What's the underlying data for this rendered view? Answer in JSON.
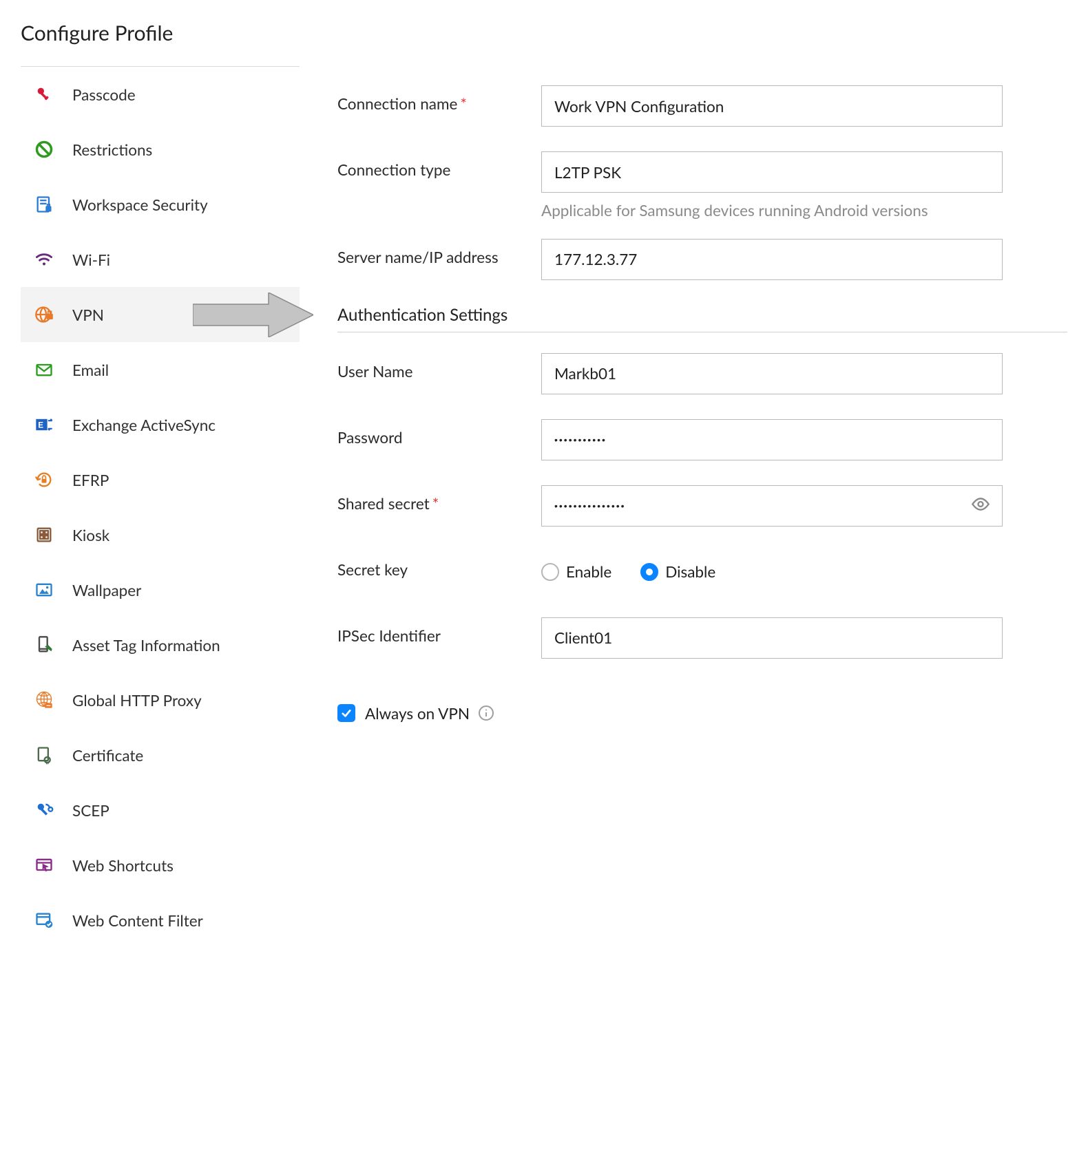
{
  "page_title": "Configure Profile",
  "sidebar": {
    "items": [
      {
        "label": "Passcode",
        "icon": "key-icon",
        "color": "#d81b3a"
      },
      {
        "label": "Restrictions",
        "icon": "prohibit-icon",
        "color": "#2e9b20"
      },
      {
        "label": "Workspace Security",
        "icon": "doc-shield-icon",
        "color": "#2c7bd4"
      },
      {
        "label": "Wi-Fi",
        "icon": "wifi-icon",
        "color": "#6a2b7a"
      },
      {
        "label": "VPN",
        "icon": "globe-lock-icon",
        "color": "#e87b2b",
        "active": true
      },
      {
        "label": "Email",
        "icon": "mail-icon",
        "color": "#2a9d1f"
      },
      {
        "label": "Exchange ActiveSync",
        "icon": "exchange-icon",
        "color": "#1e62c6"
      },
      {
        "label": "EFRP",
        "icon": "lock-rotate-icon",
        "color": "#e67e22"
      },
      {
        "label": "Kiosk",
        "icon": "kiosk-icon",
        "color": "#8a5a3b"
      },
      {
        "label": "Wallpaper",
        "icon": "image-icon",
        "color": "#2a83d1"
      },
      {
        "label": "Asset Tag Information",
        "icon": "phone-tag-icon",
        "color": "#4a4a4a"
      },
      {
        "label": "Global HTTP Proxy",
        "icon": "globe-proxy-icon",
        "color": "#e87b2b"
      },
      {
        "label": "Certificate",
        "icon": "certificate-icon",
        "color": "#4d6b4d"
      },
      {
        "label": "SCEP",
        "icon": "scep-icon",
        "color": "#1d6fd6"
      },
      {
        "label": "Web Shortcuts",
        "icon": "web-shortcut-icon",
        "color": "#8a2a8a"
      },
      {
        "label": "Web Content Filter",
        "icon": "web-filter-icon",
        "color": "#2a83d1"
      }
    ]
  },
  "form": {
    "connection_name": {
      "label": "Connection name",
      "required": true,
      "value": "Work VPN Configuration"
    },
    "connection_type": {
      "label": "Connection type",
      "value": "L2TP PSK",
      "note": "Applicable for Samsung devices running Android versions"
    },
    "server": {
      "label": "Server name/IP address",
      "value": "177.12.3.77"
    },
    "section_heading": "Authentication Settings",
    "username": {
      "label": "User Name",
      "value": "Markb01"
    },
    "password": {
      "label": "Password",
      "value": "•••••••••••"
    },
    "shared_secret": {
      "label": "Shared secret",
      "required": true,
      "value": "•••••••••••••••"
    },
    "secret_key": {
      "label": "Secret key",
      "options": {
        "enable": "Enable",
        "disable": "Disable"
      },
      "selected": "disable"
    },
    "ipsec_identifier": {
      "label": "IPSec Identifier",
      "value": "Client01"
    },
    "always_on": {
      "label": "Always on VPN",
      "checked": true
    }
  }
}
